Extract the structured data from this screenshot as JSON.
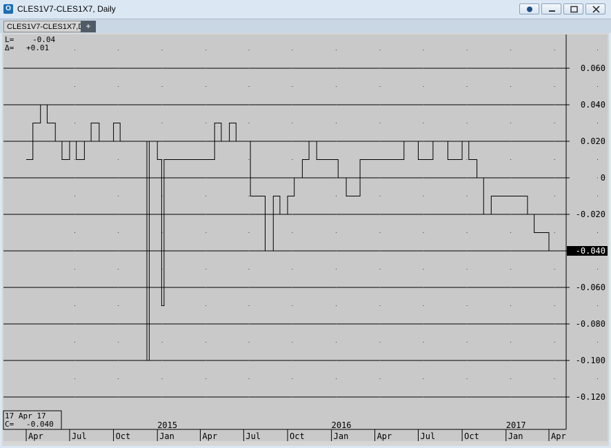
{
  "window": {
    "title": "CLES1V7-CLES1X7, Daily",
    "tab_label": "CLES1V7-CLES1X7,D",
    "tab_add": "+"
  },
  "colors": {
    "plot_bg": "#c9c9c9",
    "line": "#000000",
    "badge_bg": "#000000",
    "badge_fg": "#ffffff"
  },
  "info": {
    "l_label": "L=",
    "l_value": "-0.04",
    "d_label": "Δ=",
    "d_value": "+0.01"
  },
  "cursor": {
    "date": "17 Apr 17",
    "c_label": "C=",
    "c_value": "-0.040"
  },
  "chart_data": {
    "type": "line",
    "title": "",
    "xlabel": "",
    "ylabel": "",
    "ylim": [
      -0.13,
      0.075
    ],
    "y_ticks": [
      0.06,
      0.04,
      0.02,
      0,
      -0.02,
      -0.04,
      -0.06,
      -0.08,
      -0.1,
      -0.12
    ],
    "y_tick_labels": [
      "0.060",
      "0.040",
      "0.020",
      "0",
      "-0.020",
      "-0.040",
      "-0.060",
      "-0.080",
      "-0.100",
      "-0.120"
    ],
    "last_value": -0.04,
    "last_value_label": "-0.040",
    "month_ticks": [
      "Apr",
      "Jul",
      "Oct",
      "Jan",
      "Apr",
      "Jul",
      "Oct",
      "Jan",
      "Apr",
      "Jul",
      "Oct",
      "Jan",
      "Apr"
    ],
    "year_labels": [
      "2015",
      "2016",
      "2017"
    ],
    "grid": true,
    "series": [
      {
        "period": "Apr 2014 - Apr 2017 (daily)",
        "points": [
          [
            "2014-04-01",
            0.01
          ],
          [
            "2014-04-15",
            0.03
          ],
          [
            "2014-05-01",
            0.04
          ],
          [
            "2014-05-15",
            0.03
          ],
          [
            "2014-06-01",
            0.02
          ],
          [
            "2014-06-15",
            0.01
          ],
          [
            "2014-07-01",
            0.02
          ],
          [
            "2014-07-15",
            0.01
          ],
          [
            "2014-08-01",
            0.02
          ],
          [
            "2014-08-15",
            0.03
          ],
          [
            "2014-09-01",
            0.02
          ],
          [
            "2014-09-15",
            0.02
          ],
          [
            "2014-10-01",
            0.03
          ],
          [
            "2014-10-15",
            0.02
          ],
          [
            "2014-11-01",
            0.02
          ],
          [
            "2014-11-15",
            0.02
          ],
          [
            "2014-12-01",
            0.02
          ],
          [
            "2014-12-10",
            -0.1
          ],
          [
            "2014-12-15",
            0.02
          ],
          [
            "2015-01-01",
            0.01
          ],
          [
            "2015-01-10",
            -0.07
          ],
          [
            "2015-01-15",
            0.01
          ],
          [
            "2015-02-01",
            0.01
          ],
          [
            "2015-03-01",
            0.01
          ],
          [
            "2015-04-01",
            0.01
          ],
          [
            "2015-05-01",
            0.03
          ],
          [
            "2015-05-15",
            0.02
          ],
          [
            "2015-06-01",
            0.03
          ],
          [
            "2015-06-15",
            0.02
          ],
          [
            "2015-07-01",
            0.02
          ],
          [
            "2015-07-15",
            -0.01
          ],
          [
            "2015-08-01",
            -0.01
          ],
          [
            "2015-08-15",
            -0.04
          ],
          [
            "2015-09-01",
            -0.01
          ],
          [
            "2015-09-15",
            -0.02
          ],
          [
            "2015-10-01",
            -0.01
          ],
          [
            "2015-10-15",
            0.0
          ],
          [
            "2015-11-01",
            0.01
          ],
          [
            "2015-11-15",
            0.02
          ],
          [
            "2015-12-01",
            0.01
          ],
          [
            "2016-01-01",
            0.01
          ],
          [
            "2016-01-15",
            0.0
          ],
          [
            "2016-02-01",
            -0.01
          ],
          [
            "2016-02-15",
            -0.01
          ],
          [
            "2016-03-01",
            0.01
          ],
          [
            "2016-04-01",
            0.01
          ],
          [
            "2016-05-01",
            0.01
          ],
          [
            "2016-06-01",
            0.02
          ],
          [
            "2016-07-01",
            0.01
          ],
          [
            "2016-08-01",
            0.02
          ],
          [
            "2016-09-01",
            0.01
          ],
          [
            "2016-10-01",
            0.02
          ],
          [
            "2016-10-15",
            0.01
          ],
          [
            "2016-11-01",
            0.0
          ],
          [
            "2016-11-15",
            -0.02
          ],
          [
            "2016-12-01",
            -0.01
          ],
          [
            "2016-12-15",
            -0.01
          ],
          [
            "2017-01-01",
            -0.01
          ],
          [
            "2017-01-15",
            -0.01
          ],
          [
            "2017-02-01",
            -0.01
          ],
          [
            "2017-02-15",
            -0.02
          ],
          [
            "2017-03-01",
            -0.03
          ],
          [
            "2017-03-15",
            -0.03
          ],
          [
            "2017-04-01",
            -0.04
          ],
          [
            "2017-04-17",
            -0.04
          ]
        ]
      }
    ]
  }
}
